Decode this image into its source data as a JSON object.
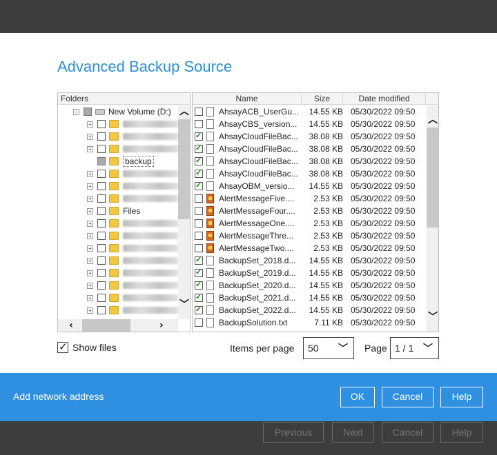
{
  "dialog": {
    "title": "Advanced Backup Source"
  },
  "tree": {
    "header": "Folders",
    "root_label": "New Volume (D:)",
    "items": [
      {
        "label": "",
        "blurred": true
      },
      {
        "label": "",
        "blurred": true
      },
      {
        "label": "",
        "blurred": true
      },
      {
        "label": "backup",
        "blurred": false
      },
      {
        "label": "",
        "blurred": true
      },
      {
        "label": "",
        "blurred": true
      },
      {
        "label": "",
        "blurred": true
      },
      {
        "label": "Files",
        "blurred": false
      },
      {
        "label": "",
        "blurred": true
      },
      {
        "label": "",
        "blurred": true
      },
      {
        "label": "",
        "blurred": true
      },
      {
        "label": "",
        "blurred": true
      },
      {
        "label": "",
        "blurred": true
      },
      {
        "label": "",
        "blurred": true
      },
      {
        "label": "",
        "blurred": true
      },
      {
        "label": "",
        "blurred": true
      }
    ]
  },
  "files": {
    "columns": {
      "name": "Name",
      "size": "Size",
      "date": "Date modified"
    },
    "rows": [
      {
        "name": "AhsayACB_UserGu...",
        "size": "14.55 KB",
        "date": "05/30/2022 09:50",
        "checked": false,
        "icon": "doc"
      },
      {
        "name": "AhsayCBS_version...",
        "size": "14.55 KB",
        "date": "05/30/2022 09:50",
        "checked": false,
        "icon": "doc"
      },
      {
        "name": "AhsayCloudFileBac...",
        "size": "38.08 KB",
        "date": "05/30/2022 09:50",
        "checked": true,
        "icon": "doc"
      },
      {
        "name": "AhsayCloudFileBac...",
        "size": "38.08 KB",
        "date": "05/30/2022 09:50",
        "checked": true,
        "icon": "doc"
      },
      {
        "name": "AhsayCloudFileBac...",
        "size": "38.08 KB",
        "date": "05/30/2022 09:50",
        "checked": true,
        "icon": "doc"
      },
      {
        "name": "AhsayCloudFileBac...",
        "size": "38.08 KB",
        "date": "05/30/2022 09:50",
        "checked": true,
        "icon": "doc"
      },
      {
        "name": "AhsayOBM_versio...",
        "size": "14.55 KB",
        "date": "05/30/2022 09:50",
        "checked": true,
        "icon": "doc"
      },
      {
        "name": "AlertMessageFive....",
        "size": "2.53 KB",
        "date": "05/30/2022 09:50",
        "checked": false,
        "icon": "img"
      },
      {
        "name": "AlertMessageFour....",
        "size": "2.53 KB",
        "date": "05/30/2022 09:50",
        "checked": false,
        "icon": "img"
      },
      {
        "name": "AlertMessageOne....",
        "size": "2.53 KB",
        "date": "05/30/2022 09:50",
        "checked": false,
        "icon": "img"
      },
      {
        "name": "AlertMessageThre...",
        "size": "2.53 KB",
        "date": "05/30/2022 09:50",
        "checked": false,
        "icon": "img"
      },
      {
        "name": "AlertMessageTwo....",
        "size": "2.53 KB",
        "date": "05/30/2022 09:50",
        "checked": false,
        "icon": "img"
      },
      {
        "name": "BackupSet_2018.d...",
        "size": "14.55 KB",
        "date": "05/30/2022 09:50",
        "checked": true,
        "icon": "doc"
      },
      {
        "name": "BackupSet_2019.d...",
        "size": "14.55 KB",
        "date": "05/30/2022 09:50",
        "checked": true,
        "icon": "doc"
      },
      {
        "name": "BackupSet_2020.d...",
        "size": "14.55 KB",
        "date": "05/30/2022 09:50",
        "checked": true,
        "icon": "doc"
      },
      {
        "name": "BackupSet_2021.d...",
        "size": "14.55 KB",
        "date": "05/30/2022 09:50",
        "checked": true,
        "icon": "doc"
      },
      {
        "name": "BackupSet_2022.d...",
        "size": "14.55 KB",
        "date": "05/30/2022 09:50",
        "checked": true,
        "icon": "doc"
      },
      {
        "name": "BackupSolution.txt",
        "size": "7.11 KB",
        "date": "05/30/2022 09:50",
        "checked": false,
        "icon": "doc"
      }
    ]
  },
  "footer": {
    "show_files_label": "Show files",
    "items_per_page_label": "Items per page",
    "items_per_page_value": "50",
    "page_label": "Page",
    "page_value": "1 / 1"
  },
  "actions": {
    "add_network": "Add network address",
    "ok": "OK",
    "cancel": "Cancel",
    "help": "Help"
  },
  "wizard": {
    "previous": "Previous",
    "next": "Next",
    "cancel": "Cancel",
    "help": "Help"
  },
  "colors": {
    "accent": "#2f8fe0",
    "title": "#2f8fd6",
    "chrome": "#3d3d3d"
  }
}
